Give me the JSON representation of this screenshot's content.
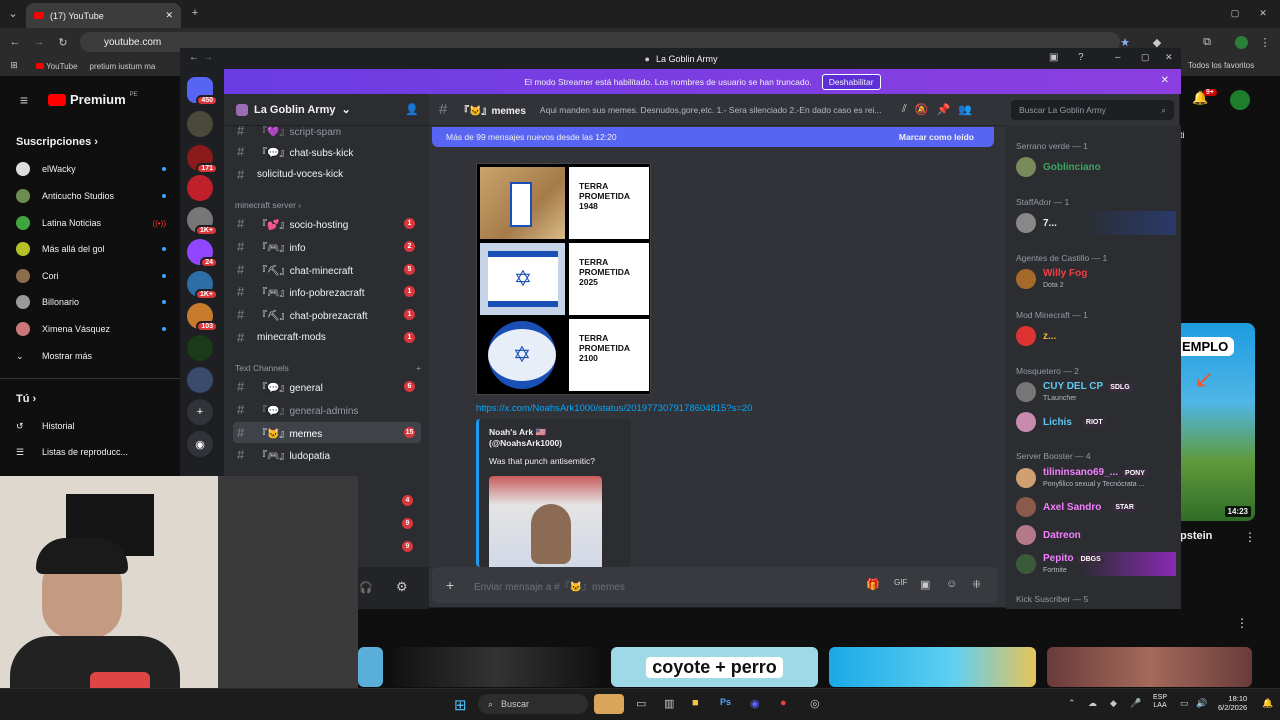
{
  "browser": {
    "tab_title": "(17) YouTube",
    "url": "youtube.com",
    "bookmarks": [
      "YouTube",
      "pretium iustum ma",
      "Todos los favoritos"
    ]
  },
  "youtube": {
    "logo": "Premium",
    "logo_sup": "PE",
    "subs_title": "Suscripciones",
    "subs": [
      "elWacky",
      "Anticucho Studios",
      "Latina Noticias",
      "Más allá del gol",
      "Cori",
      "Billonario",
      "Ximena Vásquez"
    ],
    "show_more": "Mostrar más",
    "you": "Tú",
    "history": "Historial",
    "playlists": "Listas de reproducc...",
    "right_thumb_title": "EMPLO",
    "right_thumb_duration": "14:23",
    "right_video_title": "pstein",
    "bottom_thumb_text": "coyote + perro"
  },
  "discord": {
    "window_title": "La Goblin Army",
    "banner_text": "El modo Streamer está habilitado. Los nombres de usuario se han truncado.",
    "banner_button": "Deshabilitar",
    "server_name": "La Goblin Army",
    "server_badges": [
      "450",
      "171",
      "1K+",
      "24",
      "1K+",
      "103"
    ],
    "channels_top": [
      {
        "name": "『💜』script-spam",
        "badge": ""
      },
      {
        "name": "『💬』chat-subs-kick",
        "badge": ""
      },
      {
        "name": "solicitud-voces-kick",
        "badge": ""
      }
    ],
    "category_minecraft": "minecraft server",
    "channels_minecraft": [
      {
        "name": "『💕』socio-hosting",
        "badge": "1"
      },
      {
        "name": "『🎮』info",
        "badge": "2"
      },
      {
        "name": "『⛏』chat-minecraft",
        "badge": "5"
      },
      {
        "name": "『🎮』info-pobrezacraft",
        "badge": "1"
      },
      {
        "name": "『⛏』chat-pobrezacraft",
        "badge": "1"
      },
      {
        "name": "minecraft-mods",
        "badge": "1"
      }
    ],
    "category_text": "Text Channels",
    "channels_text": [
      {
        "name": "『💬』general",
        "badge": "6"
      },
      {
        "name": "『💬』general-admins",
        "badge": ""
      },
      {
        "name": "『🐱』memes",
        "badge": "15"
      },
      {
        "name": "『🎮』ludopatia",
        "badge": ""
      }
    ],
    "lower_badges": [
      "4",
      "9",
      "9"
    ],
    "channel_name": "『🐱』memes",
    "channel_topic": "Aqui manden sus memes. Desnudos,gore,etc. 1.- Sera silenciado 2.-En dado caso es rei...",
    "search_placeholder": "Buscar La Goblin Army",
    "new_messages": "Más de 99 mensajes nuevos desde las 12:20",
    "mark_read": "Marcar como leído",
    "meme_texts": [
      "TERRA PROMETIDA 1948",
      "TERRA PROMETIDA 2025",
      "TERRA PROMETIDA 2100"
    ],
    "link": "https://x.com/NoahsArk1000/status/2019773079178604815?s=20",
    "embed_author": "Noah's Ark 🇺🇸 (@NoahsArk1000)",
    "embed_text": "Was that punch antisemitic?",
    "input_placeholder": "Enviar mensaje a #『🐱』memes",
    "members": [
      {
        "cat": "Serrano verde — 1"
      },
      {
        "name": "Goblinciano",
        "color": "#3ba55c"
      },
      {
        "cat": "StaffAdor — 1"
      },
      {
        "name": "7...",
        "color": "#f2f3f5"
      },
      {
        "cat": "Agentes de Castillo — 1"
      },
      {
        "name": "Willy Fog",
        "color": "#ed4245",
        "sub": "Dota 2"
      },
      {
        "cat": "Mod Minecraft — 1"
      },
      {
        "name": "z...",
        "color": "#f0b232"
      },
      {
        "cat": "Mosquetero — 2"
      },
      {
        "name": "CUY DEL CP",
        "color": "#5ec8f0",
        "tag": "SDLG",
        "sub": "TLauncher"
      },
      {
        "name": "Lichis",
        "color": "#5ec8f0",
        "tag": "RIOT"
      },
      {
        "cat": "Server Booster — 4"
      },
      {
        "name": "tilininsano69_...",
        "color": "#f47fff",
        "tag": "PONY",
        "sub": "Ponyfilico sexual y Tecnócrata ..."
      },
      {
        "name": "Axel Sandro",
        "color": "#f47fff",
        "tag": "STAR"
      },
      {
        "name": "Datreon",
        "color": "#f47fff"
      },
      {
        "name": "Pepito",
        "color": "#f47fff",
        "tag": "DBGS",
        "sub": "Fortnite"
      },
      {
        "cat": "Kick Suscriber — 5"
      }
    ]
  },
  "taskbar": {
    "search": "Buscar",
    "lang": "ESP",
    "lang2": "LAA",
    "time": "18:10",
    "date": "6/2/2026"
  }
}
